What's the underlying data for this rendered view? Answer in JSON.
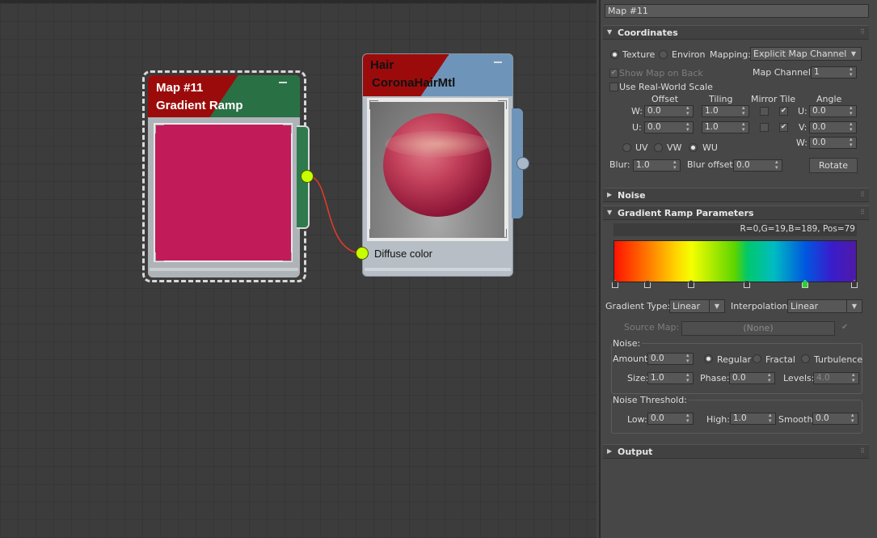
{
  "graph": {
    "gradient_node": {
      "line1": "Map #11",
      "line2": "Gradient Ramp",
      "preview_color": "#c21b5a"
    },
    "hair_node": {
      "line1": "Hair",
      "line2": "CoronaHairMtl",
      "slot_label": "Diffuse color"
    },
    "wire_color": "#e03a2a",
    "socket_color": "#c8ff00"
  },
  "panel": {
    "map_name": "Map #11",
    "coordinates": {
      "title": "Coordinates",
      "texture_label": "Texture",
      "environ_label": "Environ",
      "mapping_label": "Mapping:",
      "mapping_value": "Explicit Map Channel",
      "show_map_label": "Show Map on Back",
      "map_channel_label": "Map Channel:",
      "map_channel_value": "1",
      "real_world_label": "Use Real-World Scale",
      "col_offset": "Offset",
      "col_tiling": "Tiling",
      "col_mirror_tile": "Mirror Tile",
      "col_angle": "Angle",
      "w_label": "W:",
      "u_label": "U:",
      "offset_w": "0.0",
      "offset_u": "0.0",
      "tiling_w": "1.0",
      "tiling_u": "1.0",
      "angle_u_label": "U:",
      "angle_v_label": "V:",
      "angle_w_label": "W:",
      "angle_u": "0.0",
      "angle_v": "0.0",
      "angle_w": "0.0",
      "uv_label": "UV",
      "vw_label": "VW",
      "wu_label": "WU",
      "blur_label": "Blur:",
      "blur_value": "1.0",
      "blur_offset_label": "Blur offset:",
      "blur_offset_value": "0.0",
      "rotate_label": "Rotate"
    },
    "noise_rollout": {
      "title": "Noise"
    },
    "gradient_ramp": {
      "title": "Gradient Ramp Parameters",
      "status": "R=0,G=19,B=189, Pos=79",
      "gradient_type_label": "Gradient Type:",
      "gradient_type_value": "Linear",
      "interpolation_label": "Interpolation:",
      "interpolation_value": "Linear",
      "source_map_label": "Source Map:",
      "source_map_value": "(None)",
      "noise_group_label": "Noise:",
      "amount_label": "Amount:",
      "amount_value": "0.0",
      "regular_label": "Regular",
      "fractal_label": "Fractal",
      "turbulence_label": "Turbulence",
      "size_label": "Size:",
      "size_value": "1.0",
      "phase_label": "Phase:",
      "phase_value": "0.0",
      "levels_label": "Levels:",
      "levels_value": "4.0",
      "threshold_group_label": "Noise Threshold:",
      "low_label": "Low:",
      "low_value": "0.0",
      "high_label": "High:",
      "high_value": "1.0",
      "smooth_label": "Smooth:",
      "smooth_value": "0.0",
      "flag_positions": [
        0,
        14,
        32,
        55,
        79,
        100
      ],
      "selected_flag_index": 4
    },
    "output_rollout": {
      "title": "Output"
    }
  }
}
